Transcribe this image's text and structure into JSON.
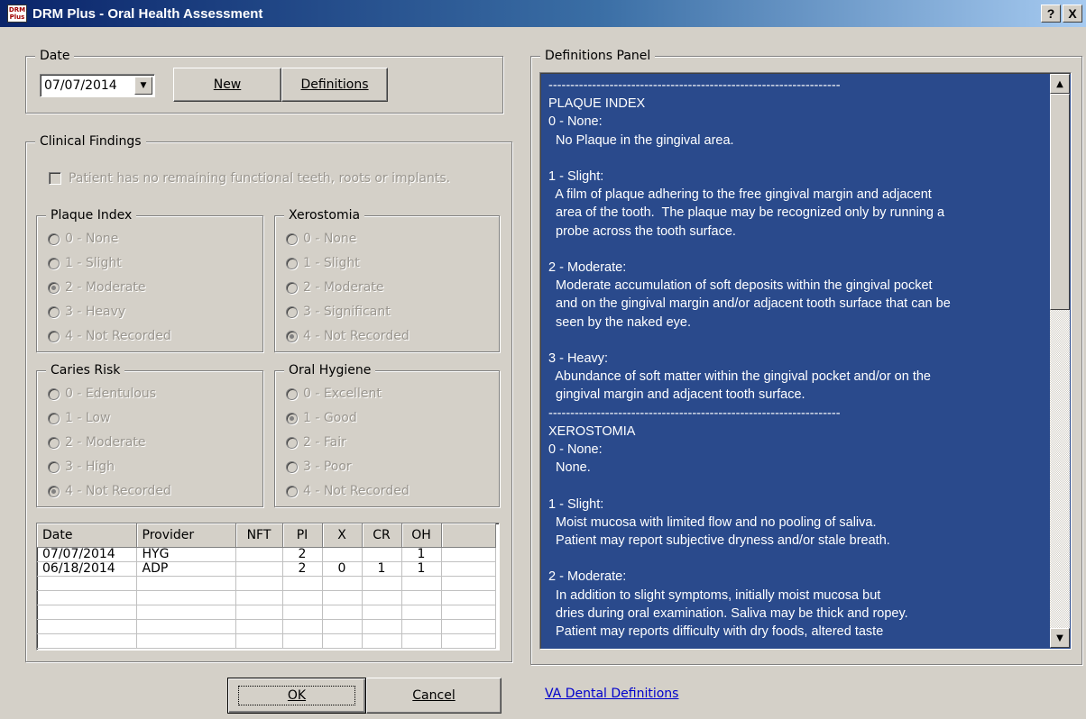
{
  "window": {
    "title": "DRM Plus - Oral Health Assessment",
    "help_label": "?",
    "close_label": "X",
    "icon_text": "DRM Plus"
  },
  "date_group": {
    "label": "Date",
    "value": "07/07/2014",
    "new_label": "New",
    "definitions_label": "Definitions"
  },
  "clinical": {
    "label": "Clinical Findings",
    "no_teeth_label": "Patient has no remaining functional teeth, roots or implants.",
    "plaque": {
      "label": "Plaque Index",
      "options": [
        "0 - None",
        "1 - Slight",
        "2 - Moderate",
        "3 - Heavy",
        "4 - Not Recorded"
      ],
      "selected": 2
    },
    "xerostomia": {
      "label": "Xerostomia",
      "options": [
        "0 - None",
        "1 - Slight",
        "2 - Moderate",
        "3 - Significant",
        "4 - Not Recorded"
      ],
      "selected": 4
    },
    "caries": {
      "label": "Caries Risk",
      "options": [
        "0 - Edentulous",
        "1 - Low",
        "2 - Moderate",
        "3 - High",
        "4 - Not Recorded"
      ],
      "selected": 4
    },
    "hygiene": {
      "label": "Oral Hygiene",
      "options": [
        "0 - Excellent",
        "1 - Good",
        "2 - Fair",
        "3 - Poor",
        "4 - Not Recorded"
      ],
      "selected": 1
    }
  },
  "history": {
    "columns": [
      "Date",
      "Provider",
      "NFT",
      "PI",
      "X",
      "CR",
      "OH"
    ],
    "rows": [
      [
        "07/07/2014",
        "HYG",
        "",
        "2",
        "",
        "",
        "1"
      ],
      [
        "06/18/2014",
        "ADP",
        "",
        "2",
        "0",
        "1",
        "1"
      ]
    ]
  },
  "definitions": {
    "label": "Definitions Panel",
    "text": "-------------------------------------------------------------------\nPLAQUE INDEX\n0 - None:\n  No Plaque in the gingival area.\n\n1 - Slight:\n  A film of plaque adhering to the free gingival margin and adjacent\n  area of the tooth.  The plaque may be recognized only by running a\n  probe across the tooth surface.\n\n2 - Moderate:\n  Moderate accumulation of soft deposits within the gingival pocket\n  and on the gingival margin and/or adjacent tooth surface that can be\n  seen by the naked eye.\n\n3 - Heavy:\n  Abundance of soft matter within the gingival pocket and/or on the\n  gingival margin and adjacent tooth surface.\n-------------------------------------------------------------------\nXEROSTOMIA\n0 - None:\n  None.\n\n1 - Slight:\n  Moist mucosa with limited flow and no pooling of saliva.\n  Patient may report subjective dryness and/or stale breath.\n\n2 - Moderate:\n  In addition to slight symptoms, initially moist mucosa but\n  dries during oral examination. Saliva may be thick and ropey.\n  Patient may reports difficulty with dry foods, altered taste",
    "link": "VA Dental Definitions"
  },
  "footer": {
    "ok_label": "OK",
    "cancel_label": "Cancel"
  }
}
